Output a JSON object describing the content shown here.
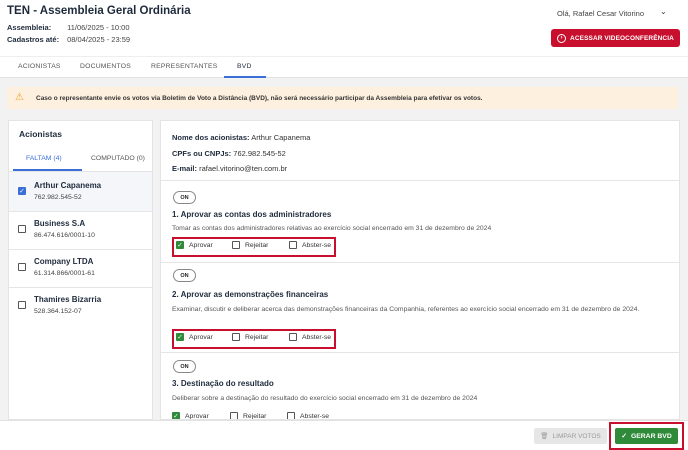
{
  "header": {
    "title": "TEN - Assembleia Geral Ordinária",
    "assembly_label": "Assembleia:",
    "assembly_value": "11/06/2025 - 10:00",
    "registration_label": "Cadastros até:",
    "registration_value": "08/04/2025 - 23:59",
    "greeting": "Olá, Rafael Cesar Vitorino",
    "video_button": "ACESSAR VIDEOCONFERÊNCIA"
  },
  "tabs": [
    "ACIONISTAS",
    "DOCUMENTOS",
    "REPRESENTANTES",
    "BVD"
  ],
  "active_tab": "BVD",
  "alert": "Caso o representante envie os votos via Boletim de Voto a Distância (BVD), não será necessário participar da Assembleia para efetivar os votos.",
  "shareholders_panel": {
    "title": "Acionistas",
    "tab_pending": "FALTAM (4)",
    "tab_computed": "COMPUTADO (0)",
    "items": [
      {
        "name": "Arthur Capanema",
        "doc": "762.982.545-52",
        "checked": true
      },
      {
        "name": "Business S.A",
        "doc": "86.474.616/0001-10",
        "checked": false
      },
      {
        "name": "Company LTDA",
        "doc": "61.314.866/0001-61",
        "checked": false
      },
      {
        "name": "Thamires Bizarria",
        "doc": "528.364.152-07",
        "checked": false
      }
    ]
  },
  "details": {
    "names_label": "Nome dos acionistas:",
    "names_value": "Arthur Capanema",
    "cpf_label": "CPFs ou CNPJs:",
    "cpf_value": "762.982.545-52",
    "email_label": "E-mail:",
    "email_value": "rafael.vitorino@ten.com.br"
  },
  "toggle_label": "ON",
  "option_labels": [
    "Aprovar",
    "Rejeitar",
    "Abster-se"
  ],
  "items": [
    {
      "title": "1. Aprovar as contas dos administradores",
      "description": "Tomar as contas dos administradores relativas ao exercício social encerrado em 31 de dezembro de 2024",
      "selected": "Aprovar"
    },
    {
      "title": "2. Aprovar as demonstrações financeiras",
      "description": "Examinar, discutir e deliberar acerca das demonstrações financeiras da Companhia, referentes ao exercício social encerrado em 31 de dezembro de 2024.",
      "selected": "Aprovar"
    },
    {
      "title": "3. Destinação do resultado",
      "description": "Deliberar sobre a destinação do resultado do exercício social encerrado em 31 de dezembro de 2024",
      "selected": "Aprovar"
    }
  ],
  "footer": {
    "clear_button": "LIMPAR VOTOS",
    "generate_button": "GERAR BVD"
  },
  "colors": {
    "primary_red": "#c8102e",
    "green": "#2f8a3a",
    "blue": "#3a6fd8",
    "alert_bg": "#fdf0df"
  }
}
